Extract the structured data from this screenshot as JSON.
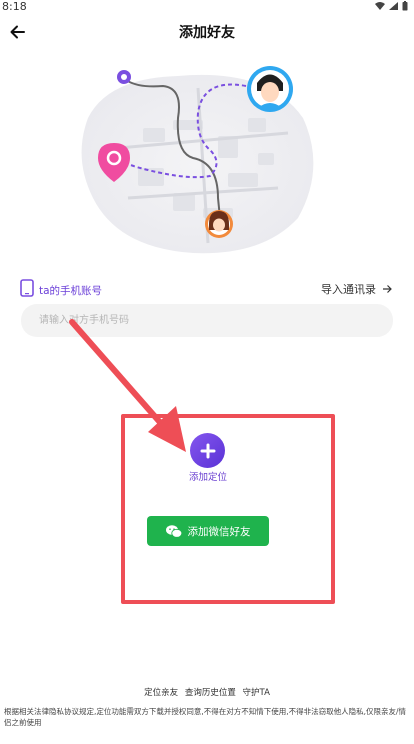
{
  "status": {
    "time": "8:18",
    "icons": [
      "wifi-icon",
      "signal-icon",
      "battery-icon"
    ]
  },
  "header": {
    "title": "添加好友",
    "back_icon": "back-arrow-icon"
  },
  "account": {
    "label": "ta的手机账号",
    "import_label": "导入通讯录",
    "phone_placeholder": "请输入对方手机号码"
  },
  "actions": {
    "add_location_label": "添加定位",
    "wechat_label": "添加微信好友"
  },
  "footer": {
    "links": [
      "定位亲友",
      "查询历史位置",
      "守护TA"
    ],
    "disclaimer": "根据相关法律隐私协议规定,定位功能需双方下载并授权同意,不得在对方不知情下使用,不得非法窃取他人隐私,仅限亲友/情侣之前使用"
  },
  "colors": {
    "accent_purple": "#6b3fd8",
    "wechat_green": "#1fb34d",
    "annotation_red": "#ee4e56",
    "pin_pink": "#f04ca0",
    "avatar_blue": "#2fa8f0",
    "avatar_orange": "#f28a3c"
  }
}
